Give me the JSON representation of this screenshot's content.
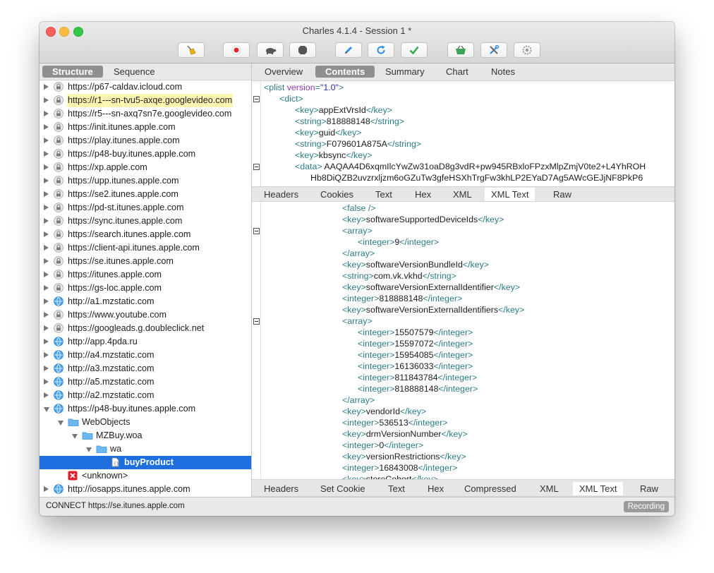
{
  "window": {
    "title": "Charles 4.1.4 - Session 1 *"
  },
  "left": {
    "tabs": [
      "Structure",
      "Sequence"
    ],
    "tree": [
      {
        "label": "https://p67-caldav.icloud.com",
        "indent": 0,
        "disc": "r",
        "icon": "lock"
      },
      {
        "label": "https://r1---sn-tvu5-axqe.googlevideo.com",
        "indent": 0,
        "disc": "r",
        "icon": "lock",
        "highlight": true
      },
      {
        "label": "https://r5---sn-axq7sn7e.googlevideo.com",
        "indent": 0,
        "disc": "r",
        "icon": "lock"
      },
      {
        "label": "https://init.itunes.apple.com",
        "indent": 0,
        "disc": "r",
        "icon": "lock"
      },
      {
        "label": "https://play.itunes.apple.com",
        "indent": 0,
        "disc": "r",
        "icon": "lock"
      },
      {
        "label": "https://p48-buy.itunes.apple.com",
        "indent": 0,
        "disc": "r",
        "icon": "lock"
      },
      {
        "label": "https://xp.apple.com",
        "indent": 0,
        "disc": "r",
        "icon": "lock"
      },
      {
        "label": "https://upp.itunes.apple.com",
        "indent": 0,
        "disc": "r",
        "icon": "lock"
      },
      {
        "label": "https://se2.itunes.apple.com",
        "indent": 0,
        "disc": "r",
        "icon": "lock"
      },
      {
        "label": "https://pd-st.itunes.apple.com",
        "indent": 0,
        "disc": "r",
        "icon": "lock"
      },
      {
        "label": "https://sync.itunes.apple.com",
        "indent": 0,
        "disc": "r",
        "icon": "lock"
      },
      {
        "label": "https://search.itunes.apple.com",
        "indent": 0,
        "disc": "r",
        "icon": "lock"
      },
      {
        "label": "https://client-api.itunes.apple.com",
        "indent": 0,
        "disc": "r",
        "icon": "lock"
      },
      {
        "label": "https://se.itunes.apple.com",
        "indent": 0,
        "disc": "r",
        "icon": "lock"
      },
      {
        "label": "https://itunes.apple.com",
        "indent": 0,
        "disc": "r",
        "icon": "lock"
      },
      {
        "label": "https://gs-loc.apple.com",
        "indent": 0,
        "disc": "r",
        "icon": "lock"
      },
      {
        "label": "http://a1.mzstatic.com",
        "indent": 0,
        "disc": "r",
        "icon": "globe"
      },
      {
        "label": "https://www.youtube.com",
        "indent": 0,
        "disc": "r",
        "icon": "lock"
      },
      {
        "label": "https://googleads.g.doubleclick.net",
        "indent": 0,
        "disc": "r",
        "icon": "lock"
      },
      {
        "label": "http://app.4pda.ru",
        "indent": 0,
        "disc": "r",
        "icon": "globe"
      },
      {
        "label": "http://a4.mzstatic.com",
        "indent": 0,
        "disc": "r",
        "icon": "globe"
      },
      {
        "label": "http://a3.mzstatic.com",
        "indent": 0,
        "disc": "r",
        "icon": "globe"
      },
      {
        "label": "http://a5.mzstatic.com",
        "indent": 0,
        "disc": "r",
        "icon": "globe"
      },
      {
        "label": "http://a2.mzstatic.com",
        "indent": 0,
        "disc": "r",
        "icon": "globe"
      },
      {
        "label": "https://p48-buy.itunes.apple.com",
        "indent": 0,
        "disc": "d",
        "icon": "globe"
      },
      {
        "label": "WebObjects",
        "indent": 1,
        "disc": "d",
        "icon": "folder"
      },
      {
        "label": "MZBuy.woa",
        "indent": 2,
        "disc": "d",
        "icon": "folder"
      },
      {
        "label": "wa",
        "indent": 3,
        "disc": "d",
        "icon": "folder"
      },
      {
        "label": "buyProduct",
        "indent": 4,
        "disc": "",
        "icon": "doc",
        "selected": true
      },
      {
        "label": "<unknown>",
        "indent": 1,
        "disc": "",
        "icon": "error"
      },
      {
        "label": "http://iosapps.itunes.apple.com",
        "indent": 0,
        "disc": "r",
        "icon": "globe"
      }
    ]
  },
  "right": {
    "top_tabs": [
      "Overview",
      "Contents",
      "Summary",
      "Chart",
      "Notes"
    ],
    "request_tabs": [
      "Headers",
      "Cookies",
      "Text",
      "Hex",
      "XML",
      "XML Text",
      "Raw"
    ],
    "response_tabs": [
      "Headers",
      "Set Cookie",
      "Text",
      "Hex",
      "Compressed",
      "XML",
      "XML Text",
      "Raw"
    ],
    "request_xml": [
      {
        "indent": 0,
        "fold": false,
        "segs": [
          [
            "t",
            "<plist "
          ],
          [
            "a",
            "version"
          ],
          [
            "t",
            "="
          ],
          [
            "v",
            "\"1.0\""
          ],
          [
            "t",
            ">"
          ]
        ]
      },
      {
        "indent": 1,
        "fold": true,
        "segs": [
          [
            "t",
            "<dict>"
          ]
        ]
      },
      {
        "indent": 2,
        "fold": false,
        "segs": [
          [
            "t",
            "<key>"
          ],
          [
            "x",
            "appExtVrsId"
          ],
          [
            "t",
            "</key>"
          ]
        ]
      },
      {
        "indent": 2,
        "fold": false,
        "segs": [
          [
            "t",
            "<string>"
          ],
          [
            "x",
            "818888148"
          ],
          [
            "t",
            "</string>"
          ]
        ]
      },
      {
        "indent": 2,
        "fold": false,
        "segs": [
          [
            "t",
            "<key>"
          ],
          [
            "x",
            "guid"
          ],
          [
            "t",
            "</key>"
          ]
        ]
      },
      {
        "indent": 2,
        "fold": false,
        "segs": [
          [
            "t",
            "<string>"
          ],
          [
            "x",
            "F079601A875A"
          ],
          [
            "t",
            "</string>"
          ]
        ]
      },
      {
        "indent": 2,
        "fold": false,
        "segs": [
          [
            "t",
            "<key>"
          ],
          [
            "x",
            "kbsync"
          ],
          [
            "t",
            "</key>"
          ]
        ]
      },
      {
        "indent": 2,
        "fold": true,
        "segs": [
          [
            "t",
            "<data>"
          ],
          [
            "x",
            " AAQAA4D6xqmIlcYwZw31oaD8g3vdR+pw945RBxloFPzxMlpZmjV0te2+L4YhROH"
          ]
        ]
      },
      {
        "indent": 3,
        "fold": false,
        "segs": [
          [
            "x",
            "Hb8DiQZB2uvzrxljzm6oGZuTw3gfeHSXhTrgFw3khLP2EYaD7Ag5AWcGEJjNF8PkP6"
          ]
        ]
      }
    ],
    "response_xml": [
      {
        "indent": 0,
        "fold": false,
        "segs": [
          [
            "t",
            "<false />"
          ]
        ]
      },
      {
        "indent": 0,
        "fold": false,
        "segs": [
          [
            "t",
            "<key>"
          ],
          [
            "x",
            "softwareSupportedDeviceIds"
          ],
          [
            "t",
            "</key>"
          ]
        ]
      },
      {
        "indent": 0,
        "fold": true,
        "segs": [
          [
            "t",
            "<array>"
          ]
        ]
      },
      {
        "indent": 1,
        "fold": false,
        "segs": [
          [
            "t",
            "<integer>"
          ],
          [
            "x",
            "9"
          ],
          [
            "t",
            "</integer>"
          ]
        ]
      },
      {
        "indent": 0,
        "fold": false,
        "segs": [
          [
            "t",
            "</array>"
          ]
        ]
      },
      {
        "indent": 0,
        "fold": false,
        "segs": [
          [
            "t",
            "<key>"
          ],
          [
            "x",
            "softwareVersionBundleId"
          ],
          [
            "t",
            "</key>"
          ]
        ]
      },
      {
        "indent": 0,
        "fold": false,
        "segs": [
          [
            "t",
            "<string>"
          ],
          [
            "x",
            "com.vk.vkhd"
          ],
          [
            "t",
            "</string>"
          ]
        ]
      },
      {
        "indent": 0,
        "fold": false,
        "segs": [
          [
            "t",
            "<key>"
          ],
          [
            "x",
            "softwareVersionExternalIdentifier"
          ],
          [
            "t",
            "</key>"
          ]
        ]
      },
      {
        "indent": 0,
        "fold": false,
        "segs": [
          [
            "t",
            "<integer>"
          ],
          [
            "x",
            "818888148"
          ],
          [
            "t",
            "</integer>"
          ]
        ]
      },
      {
        "indent": 0,
        "fold": false,
        "segs": [
          [
            "t",
            "<key>"
          ],
          [
            "x",
            "softwareVersionExternalIdentifiers"
          ],
          [
            "t",
            "</key>"
          ]
        ]
      },
      {
        "indent": 0,
        "fold": true,
        "segs": [
          [
            "t",
            "<array>"
          ]
        ]
      },
      {
        "indent": 1,
        "fold": false,
        "segs": [
          [
            "t",
            "<integer>"
          ],
          [
            "x",
            "15507579"
          ],
          [
            "t",
            "</integer>"
          ]
        ]
      },
      {
        "indent": 1,
        "fold": false,
        "segs": [
          [
            "t",
            "<integer>"
          ],
          [
            "x",
            "15597072"
          ],
          [
            "t",
            "</integer>"
          ]
        ]
      },
      {
        "indent": 1,
        "fold": false,
        "segs": [
          [
            "t",
            "<integer>"
          ],
          [
            "x",
            "15954085"
          ],
          [
            "t",
            "</integer>"
          ]
        ]
      },
      {
        "indent": 1,
        "fold": false,
        "segs": [
          [
            "t",
            "<integer>"
          ],
          [
            "x",
            "16136033"
          ],
          [
            "t",
            "</integer>"
          ]
        ]
      },
      {
        "indent": 1,
        "fold": false,
        "segs": [
          [
            "t",
            "<integer>"
          ],
          [
            "x",
            "811843784"
          ],
          [
            "t",
            "</integer>"
          ]
        ]
      },
      {
        "indent": 1,
        "fold": false,
        "segs": [
          [
            "t",
            "<integer>"
          ],
          [
            "x",
            "818888148"
          ],
          [
            "t",
            "</integer>"
          ]
        ]
      },
      {
        "indent": 0,
        "fold": false,
        "segs": [
          [
            "t",
            "</array>"
          ]
        ]
      },
      {
        "indent": 0,
        "fold": false,
        "segs": [
          [
            "t",
            "<key>"
          ],
          [
            "x",
            "vendorId"
          ],
          [
            "t",
            "</key>"
          ]
        ]
      },
      {
        "indent": 0,
        "fold": false,
        "segs": [
          [
            "t",
            "<integer>"
          ],
          [
            "x",
            "536513"
          ],
          [
            "t",
            "</integer>"
          ]
        ]
      },
      {
        "indent": 0,
        "fold": false,
        "segs": [
          [
            "t",
            "<key>"
          ],
          [
            "x",
            "drmVersionNumber"
          ],
          [
            "t",
            "</key>"
          ]
        ]
      },
      {
        "indent": 0,
        "fold": false,
        "segs": [
          [
            "t",
            "<integer>"
          ],
          [
            "x",
            "0"
          ],
          [
            "t",
            "</integer>"
          ]
        ]
      },
      {
        "indent": 0,
        "fold": false,
        "segs": [
          [
            "t",
            "<key>"
          ],
          [
            "x",
            "versionRestrictions"
          ],
          [
            "t",
            "</key>"
          ]
        ]
      },
      {
        "indent": 0,
        "fold": false,
        "segs": [
          [
            "t",
            "<integer>"
          ],
          [
            "x",
            "16843008"
          ],
          [
            "t",
            "</integer>"
          ]
        ]
      },
      {
        "indent": 0,
        "fold": false,
        "segs": [
          [
            "t",
            "<key>"
          ],
          [
            "x",
            "storeCohort"
          ],
          [
            "t",
            "</key>"
          ]
        ]
      }
    ]
  },
  "status": {
    "text": "CONNECT https://se.itunes.apple.com",
    "badge": "Recording"
  },
  "toolbar": [
    {
      "name": "broom-icon"
    },
    {
      "name": "record-icon"
    },
    {
      "name": "turtle-icon"
    },
    {
      "name": "stop-icon"
    },
    {
      "name": "pen-icon"
    },
    {
      "name": "refresh-icon"
    },
    {
      "name": "checkmark-icon"
    },
    {
      "name": "basket-icon"
    },
    {
      "name": "tools-icon"
    },
    {
      "name": "settings-icon"
    }
  ],
  "colors": {
    "selection": "#1f6ede",
    "tag": "#2c7c86",
    "attr": "#8c3aa8",
    "value": "#2a2aa8",
    "highlight": "#fdf6b2"
  }
}
